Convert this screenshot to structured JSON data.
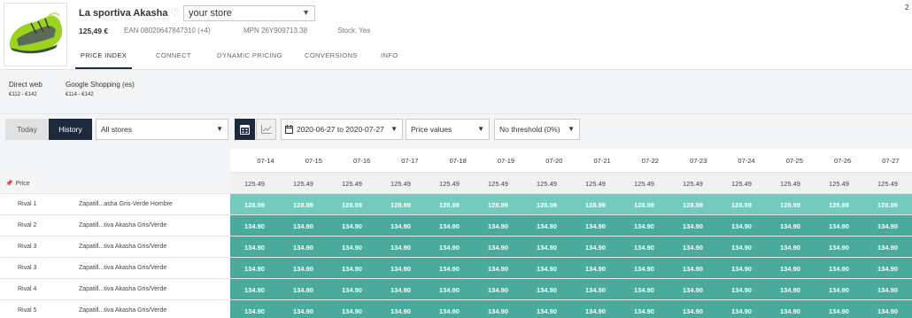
{
  "product": {
    "title": "La sportiva Akasha",
    "heart_icon": "♡",
    "price": "125,49 €",
    "ean": "EAN 08020647847310 (+4)",
    "mpn": "MPN 26Y909713.38",
    "stock": "Stock: Yes",
    "store_select": "your store",
    "corner_number": "2"
  },
  "tabs": [
    {
      "label": "PRICE INDEX",
      "active": true
    },
    {
      "label": "CONNECT"
    },
    {
      "label": "DYNAMIC PRICING"
    },
    {
      "label": "CONVERSIONS"
    },
    {
      "label": "INFO"
    }
  ],
  "channels": [
    {
      "name": "Direct web",
      "range": "€112 - €142",
      "active": true
    },
    {
      "name": "Google Shopping (es)",
      "range": "€114 - €142"
    }
  ],
  "toolbar": {
    "today": "Today",
    "history": "History",
    "stores": "All stores",
    "date_range": "2020-06-27 to 2020-07-27",
    "values": "Price values",
    "threshold": "No threshold (0%)"
  },
  "table": {
    "dates": [
      "07-14",
      "07-15",
      "07-16",
      "07-17",
      "07-18",
      "07-19",
      "07-20",
      "07-21",
      "07-22",
      "07-23",
      "07-24",
      "07-25",
      "07-26",
      "07-27"
    ],
    "price_row": {
      "label": "Price",
      "values": [
        "125.49",
        "125.49",
        "125.49",
        "125.49",
        "125.49",
        "125.49",
        "125.49",
        "125.49",
        "125.49",
        "125.49",
        "125.49",
        "125.49",
        "125.49",
        "125.49"
      ]
    },
    "rivals": [
      {
        "name": "Rival 1",
        "desc": "Zapatill...asha Gris-Verde Hombre",
        "color": "#74cbbd",
        "values": [
          "128.99",
          "128.99",
          "128.99",
          "128.99",
          "128.99",
          "128.99",
          "128.99",
          "128.99",
          "128.99",
          "128.99",
          "128.99",
          "128.99",
          "128.99",
          "128.99"
        ]
      },
      {
        "name": "Rival 2",
        "desc": "Zapatill...tiva Akasha Gris/Verde",
        "color": "#4aab9d",
        "values": [
          "134.90",
          "134.90",
          "134.90",
          "134.90",
          "134.90",
          "134.90",
          "134.90",
          "134.90",
          "134.90",
          "134.90",
          "134.90",
          "134.90",
          "134.90",
          "134.90"
        ]
      },
      {
        "name": "Rival 3",
        "desc": "Zapatill...tiva Akasha Gris/Verde",
        "color": "#4aab9d",
        "values": [
          "134.90",
          "134.90",
          "134.90",
          "134.90",
          "134.90",
          "134.90",
          "134.90",
          "134.90",
          "134.90",
          "134.90",
          "134.90",
          "134.90",
          "134.90",
          "134.90"
        ]
      },
      {
        "name": "Rival 3",
        "desc": "Zapatill...tiva Akasha Gris/Verde",
        "color": "#4aab9d",
        "values": [
          "134.90",
          "134.90",
          "134.90",
          "134.90",
          "134.90",
          "134.90",
          "134.90",
          "134.90",
          "134.90",
          "134.90",
          "134.90",
          "134.90",
          "134.90",
          "134.90"
        ]
      },
      {
        "name": "Rival 4",
        "desc": "Zapatill...tiva Akasha Gris/Verde",
        "color": "#4aab9d",
        "values": [
          "134.90",
          "134.90",
          "134.90",
          "134.90",
          "134.90",
          "134.90",
          "134.90",
          "134.90",
          "134.90",
          "134.90",
          "134.90",
          "134.90",
          "134.90",
          "134.90"
        ]
      },
      {
        "name": "Rival 5",
        "desc": "Zapatill...tiva Akasha Gris/Verde",
        "color": "#4aab9d",
        "values": [
          "134.90",
          "134.90",
          "134.90",
          "134.90",
          "134.90",
          "134.90",
          "134.90",
          "134.90",
          "134.90",
          "134.90",
          "134.90",
          "134.90",
          "134.90",
          "134.90"
        ]
      }
    ]
  },
  "colors": {
    "accent_dark": "#1d2a3d",
    "rival_light": "#74cbbd",
    "rival_dark": "#4aab9d"
  }
}
